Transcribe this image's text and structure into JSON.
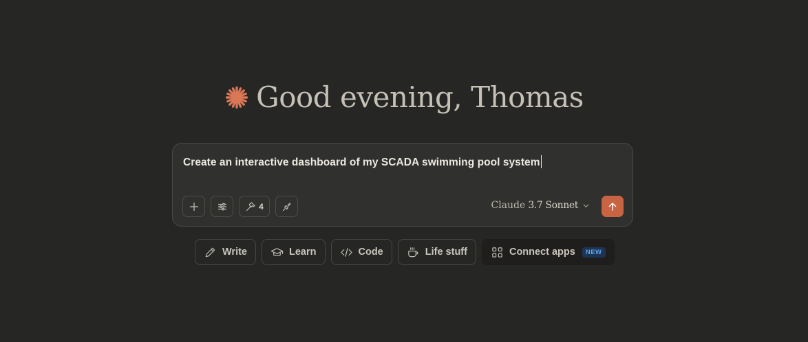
{
  "greeting": {
    "icon": "claude-spark-icon",
    "text": "Good evening, Thomas",
    "accent_color": "#d97757"
  },
  "composer": {
    "input_value": "Create an interactive dashboard of my SCADA swimming pool system",
    "tools": [
      {
        "name": "add",
        "icon": "plus-icon"
      },
      {
        "name": "options",
        "icon": "sliders-icon"
      },
      {
        "name": "tools",
        "icon": "hammer-icon",
        "count": "4"
      },
      {
        "name": "integrations",
        "icon": "plug-icon"
      }
    ],
    "model": {
      "brand": "Claude",
      "version": "3.7 Sonnet"
    },
    "send": {
      "icon": "arrow-up-icon",
      "color": "#c96442"
    }
  },
  "suggestions": [
    {
      "label": "Write",
      "icon": "pencil-icon"
    },
    {
      "label": "Learn",
      "icon": "graduation-cap-icon"
    },
    {
      "label": "Code",
      "icon": "code-icon"
    },
    {
      "label": "Life stuff",
      "icon": "coffee-cup-icon"
    },
    {
      "label": "Connect apps",
      "icon": "grid-icon",
      "badge": "NEW"
    }
  ]
}
